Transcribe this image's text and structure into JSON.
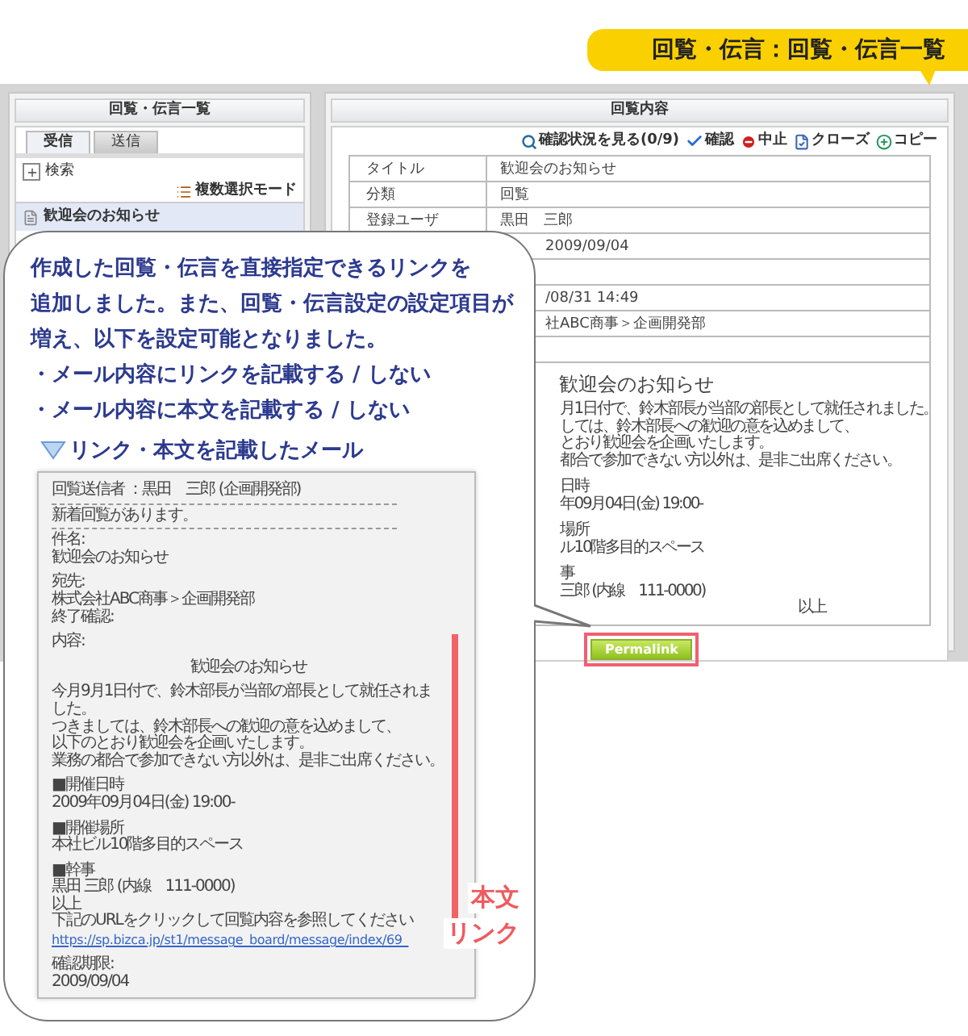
{
  "banner": {
    "title": "回覧・伝言：回覧・伝言一覧"
  },
  "left_panel": {
    "title": "回覧・伝言一覧",
    "tabs": [
      {
        "label": "受信",
        "selected": true
      },
      {
        "label": "送信",
        "selected": false
      }
    ],
    "search": "検索",
    "multi_select": "複数選択モード",
    "items": [
      {
        "label": "歓迎会のお知らせ",
        "selected": true
      }
    ]
  },
  "right_panel": {
    "title": "回覧内容",
    "toolbar": [
      {
        "kind": "status",
        "label": "確認状況を見る(0/9)"
      },
      {
        "kind": "confirm",
        "label": "確認"
      },
      {
        "kind": "stop",
        "label": "中止"
      },
      {
        "kind": "close",
        "label": "クローズ"
      },
      {
        "kind": "copy",
        "label": "コピー"
      }
    ],
    "rows": [
      {
        "label": "タイトル",
        "value": "歓迎会のお知らせ"
      },
      {
        "label": "分類",
        "value": "回覧"
      },
      {
        "label": "登録ユーザ",
        "value": "黒田　三郎"
      },
      {
        "value": "2009/09/04"
      },
      {
        "value": ""
      },
      {
        "value": "/08/31 14:49"
      },
      {
        "value": "社ABC商事＞企画開発部"
      },
      {
        "value": ""
      }
    ],
    "body_title": "歓迎会のお知らせ",
    "body_lines": [
      {
        "kind": "text",
        "text": "月1日付で、鈴木部長が当部の部長として就任されました。"
      },
      {
        "kind": "text",
        "text": "しては、鈴木部長への歓迎の意を込めまして、"
      },
      {
        "kind": "text",
        "text": "とおり歓迎会を企画いたします。"
      },
      {
        "kind": "text",
        "text": "都合で参加できない方以外は、是非ご出席ください。"
      },
      {
        "kind": "blank"
      },
      {
        "kind": "text",
        "text": "日時"
      },
      {
        "kind": "text",
        "text": "年09月04日(金)  19:00-"
      },
      {
        "kind": "blank"
      },
      {
        "kind": "text",
        "text": "場所"
      },
      {
        "kind": "text",
        "text": "ル10階多目的スペース"
      },
      {
        "kind": "blank"
      },
      {
        "kind": "text",
        "text": "事"
      },
      {
        "kind": "text",
        "text": "三郎 (内線　111-0000)"
      },
      {
        "kind": "right",
        "text": "以上"
      }
    ],
    "permalink": "Permalink"
  },
  "callout": {
    "paragraph_lines": [
      "作成した回覧・伝言を直接指定できるリンクを",
      "追加しました。また、回覧・伝言設定の設定項目が",
      "増え、以下を設定可能となりました。"
    ],
    "bullets": [
      "・メール内容にリンクを記載する / しない",
      "・メール内容に本文を記載する / しない"
    ],
    "heading": "リンク・本文を記載したメール",
    "email_sections": [
      {
        "kind": "plain",
        "lines": [
          {
            "kind": "text",
            "text": "回覧送信者 ：黒田　三郎 (企画開発部)"
          },
          {
            "kind": "rule"
          },
          {
            "kind": "text",
            "text": "新着回覧があります。"
          },
          {
            "kind": "rule"
          },
          {
            "kind": "text",
            "text": "件名:"
          },
          {
            "kind": "text",
            "text": "歓迎会のお知らせ"
          },
          {
            "kind": "blank"
          },
          {
            "kind": "text",
            "text": "宛先:"
          },
          {
            "kind": "text",
            "text": "株式会社ABC商事＞企画開発部"
          },
          {
            "kind": "text",
            "text": "終了確認:"
          },
          {
            "kind": "blank"
          }
        ]
      },
      {
        "kind": "marked",
        "label": "本文",
        "lines": [
          {
            "kind": "text",
            "text": "内容:"
          },
          {
            "kind": "blank"
          },
          {
            "kind": "center",
            "text": "歓迎会のお知らせ"
          },
          {
            "kind": "blank"
          },
          {
            "kind": "text",
            "text": "今月9月1日付で、鈴木部長が当部の部長として就任されました。"
          },
          {
            "kind": "text",
            "text": "つきましては、鈴木部長への歓迎の意を込めまして、"
          },
          {
            "kind": "text",
            "text": "以下のとおり歓迎会を企画いたします。"
          },
          {
            "kind": "text",
            "text": "業務の都合で参加できない方以外は、是非ご出席ください。"
          },
          {
            "kind": "blank"
          },
          {
            "kind": "text",
            "text": "■開催日時"
          },
          {
            "kind": "text",
            "text": "2009年09月04日(金)  19:00-"
          },
          {
            "kind": "blank"
          },
          {
            "kind": "text",
            "text": "■開催場所"
          },
          {
            "kind": "text",
            "text": "本社ビル10階多目的スペース"
          },
          {
            "kind": "blank"
          },
          {
            "kind": "text",
            "text": "■幹事"
          },
          {
            "kind": "text",
            "text": "黒田 三郎 (内線　111-0000)"
          },
          {
            "kind": "text",
            "text": "以上"
          }
        ]
      },
      {
        "kind": "marked",
        "label": "リンク",
        "lines": [
          {
            "kind": "text",
            "text": "下記のURLをクリックして回覧内容を参照してください"
          },
          {
            "kind": "link",
            "text": "https://sp.bizca.jp/st1/message_board/message/index/69_"
          }
        ]
      },
      {
        "kind": "plain",
        "lines": [
          {
            "kind": "blank"
          },
          {
            "kind": "text",
            "text": "確認期限:"
          },
          {
            "kind": "text",
            "text": "2009/09/04"
          }
        ]
      }
    ]
  }
}
